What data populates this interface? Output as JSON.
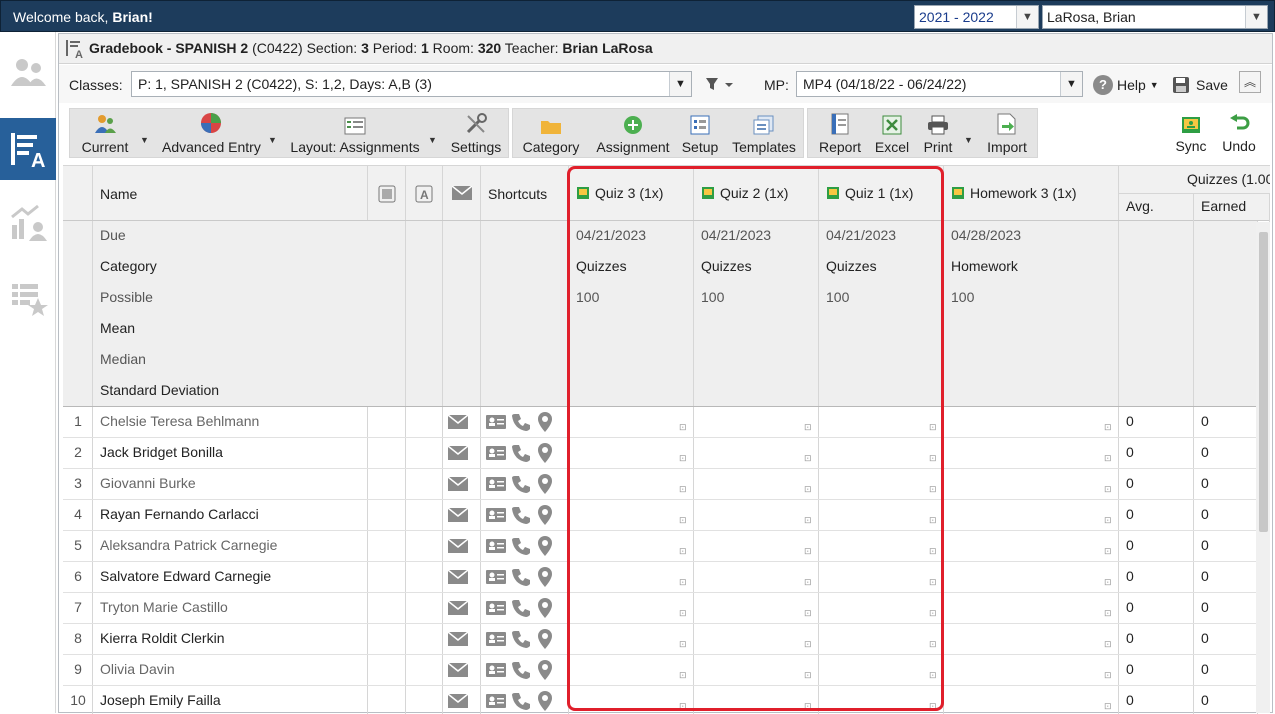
{
  "topbar": {
    "welcome_prefix": "Welcome back, ",
    "welcome_name": "Brian!",
    "year": "2021 - 2022",
    "user": "LaRosa, Brian"
  },
  "window": {
    "title_app": "Gradebook - SPANISH 2",
    "title_code": "(C0422) Section: ",
    "section": "3",
    "period_label": " Period: ",
    "period": "1",
    "room_label": " Room: ",
    "room": "320",
    "teacher_label": " Teacher: ",
    "teacher": "Brian LaRosa"
  },
  "classes": {
    "label": "Classes:",
    "value": "P: 1, SPANISH 2 (C0422), S: 1,2, Days: A,B (3)",
    "mp_label": "MP:",
    "mp_value": "MP4 (04/18/22 - 06/24/22)",
    "help": "Help",
    "save": "Save"
  },
  "toolbar": {
    "current": "Current",
    "advanced_entry": "Advanced Entry",
    "layout": "Layout: Assignments",
    "settings": "Settings",
    "category": "Category",
    "assignment": "Assignment",
    "setup": "Setup",
    "templates": "Templates",
    "report": "Report",
    "excel": "Excel",
    "print": "Print",
    "import": "Import",
    "sync": "Sync",
    "undo": "Undo"
  },
  "grid": {
    "headers": {
      "name": "Name",
      "shortcuts": "Shortcuts",
      "quizzes_group": "Quizzes (1.00",
      "avg": "Avg.",
      "earned": "Earned"
    },
    "meta_labels": [
      "Due",
      "Category",
      "Possible",
      "Mean",
      "Median",
      "Standard Deviation"
    ],
    "assignments": [
      {
        "name": "Quiz 3 (1x)",
        "due": "04/21/2023",
        "category": "Quizzes",
        "possible": "100"
      },
      {
        "name": "Quiz 2 (1x)",
        "due": "04/21/2023",
        "category": "Quizzes",
        "possible": "100"
      },
      {
        "name": "Quiz 1 (1x)",
        "due": "04/21/2023",
        "category": "Quizzes",
        "possible": "100"
      },
      {
        "name": "Homework 3 (1x)",
        "due": "04/28/2023",
        "category": "Homework",
        "possible": "100"
      }
    ],
    "students": [
      {
        "num": "1",
        "name": "Chelsie Teresa Behlmann",
        "avg": "0",
        "earned": "0"
      },
      {
        "num": "2",
        "name": "Jack Bridget Bonilla",
        "avg": "0",
        "earned": "0"
      },
      {
        "num": "3",
        "name": "Giovanni Burke",
        "avg": "0",
        "earned": "0"
      },
      {
        "num": "4",
        "name": "Rayan Fernando Carlacci",
        "avg": "0",
        "earned": "0"
      },
      {
        "num": "5",
        "name": "Aleksandra Patrick Carnegie",
        "avg": "0",
        "earned": "0"
      },
      {
        "num": "6",
        "name": "Salvatore Edward Carnegie",
        "avg": "0",
        "earned": "0"
      },
      {
        "num": "7",
        "name": "Tryton Marie Castillo",
        "avg": "0",
        "earned": "0"
      },
      {
        "num": "8",
        "name": "Kierra Roldit Clerkin",
        "avg": "0",
        "earned": "0"
      },
      {
        "num": "9",
        "name": "Olivia Davin",
        "avg": "0",
        "earned": "0"
      },
      {
        "num": "10",
        "name": "Joseph Emily Failla",
        "avg": "0",
        "earned": "0"
      }
    ]
  },
  "colors": {
    "topbar": "#1d3c5c",
    "nav_active": "#27609a",
    "highlight": "#e01f2b"
  }
}
